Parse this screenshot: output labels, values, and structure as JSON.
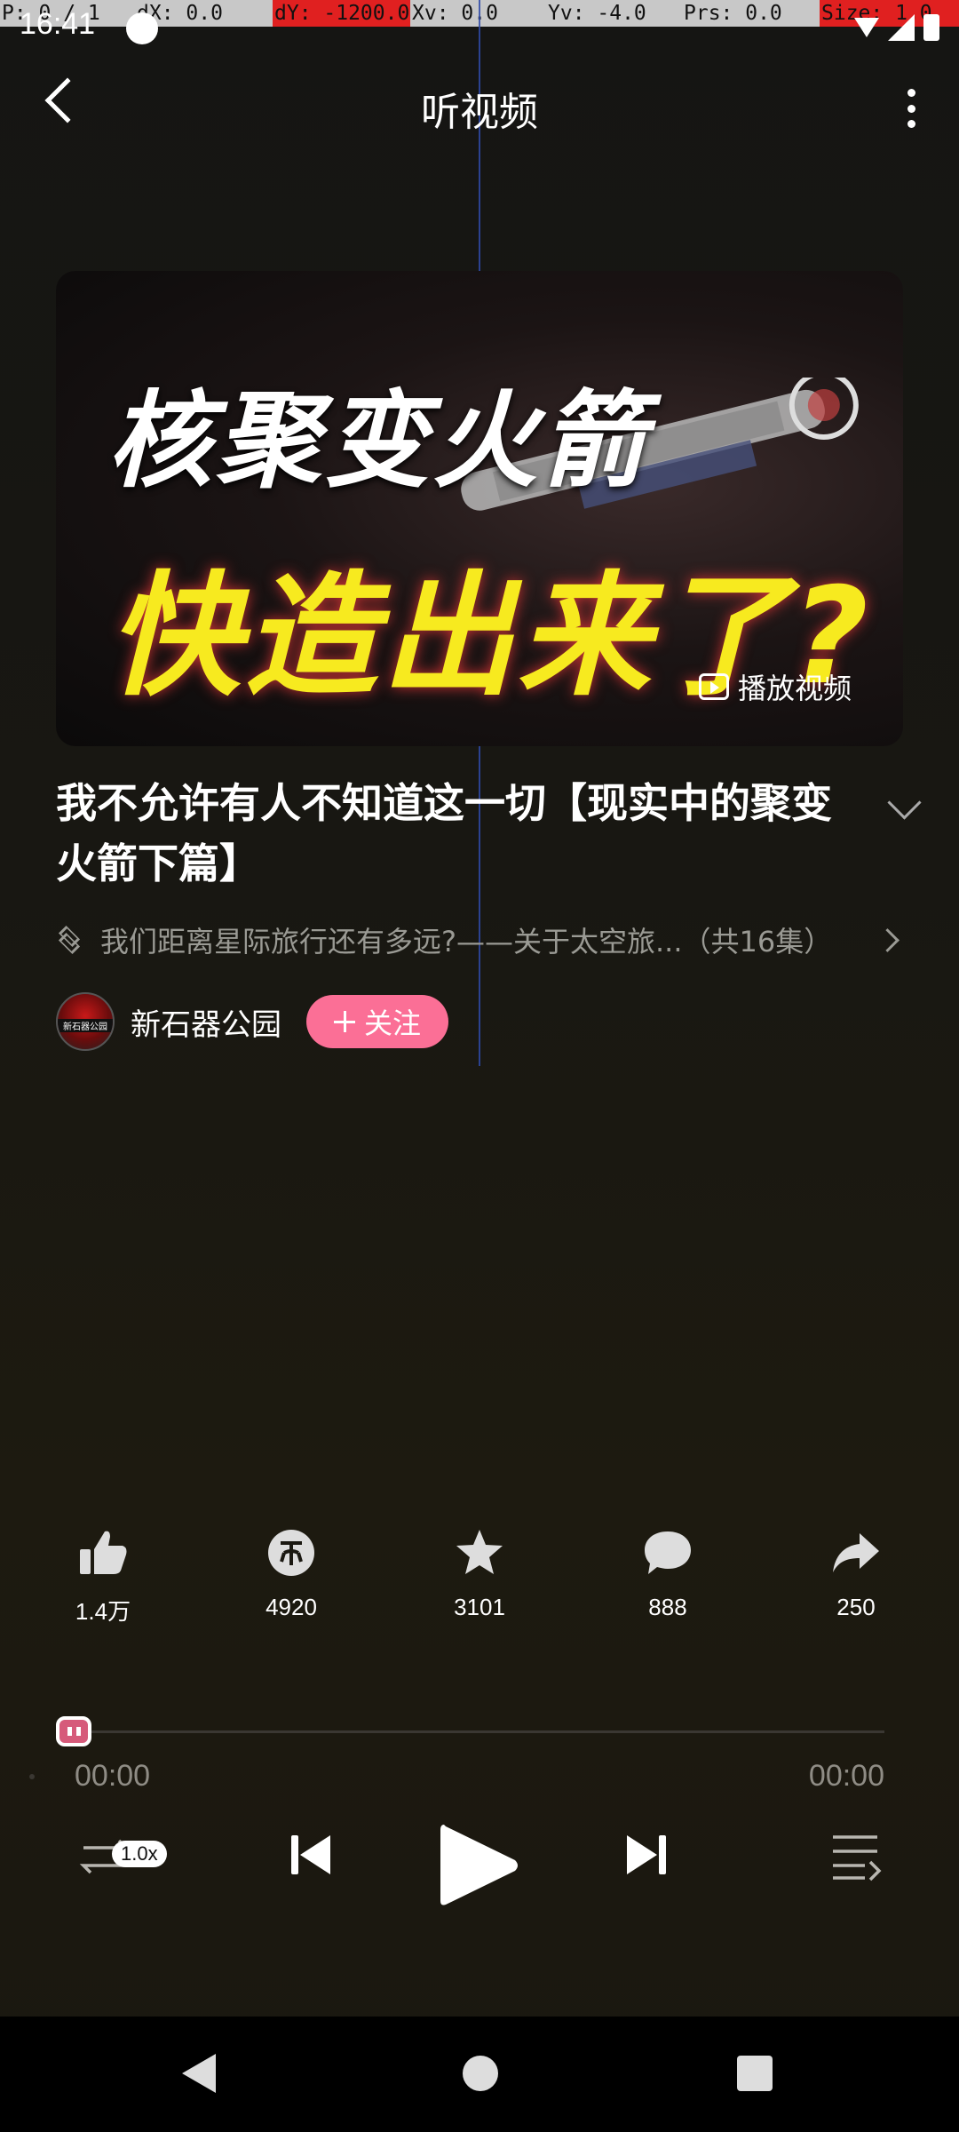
{
  "debug": {
    "cells": [
      {
        "text": "P: 0 / 1",
        "color": "#c8c8c8",
        "width": 152
      },
      {
        "text": "dX: 0.0",
        "color": "#c8c8c8",
        "width": 155
      },
      {
        "text": "dY: -1200.0",
        "color": "#e02020",
        "width": 155
      },
      {
        "text": "Xv: 0.0",
        "color": "#c8c8c8",
        "width": 153
      },
      {
        "text": "Yv: -4.0",
        "color": "#c8c8c8",
        "width": 153
      },
      {
        "text": "Prs: 0.0",
        "color": "#c8c8c8",
        "width": 155
      },
      {
        "text": "Size: 1.0",
        "color": "#e02020",
        "width": 157
      }
    ]
  },
  "status_bar": {
    "time": "16:41"
  },
  "header": {
    "title": "听视频"
  },
  "cover": {
    "line1": "核聚变火箭",
    "line2": "快造出来了?",
    "play_label": "播放视频"
  },
  "episode": {
    "title": "我不允许有人不知道这一切【现实中的聚变火箭下篇】",
    "series": "我们距离星际旅行还有多远?——关于太空旅...（共16集）"
  },
  "author": {
    "name": "新石器公园",
    "avatar_text": "新石器公园",
    "follow_label": "关注"
  },
  "actions": {
    "like": "1.4万",
    "coin": "4920",
    "favorite": "3101",
    "comment": "888",
    "share": "250"
  },
  "player": {
    "elapsed": "00:00",
    "duration": "00:00",
    "speed": "1.0x",
    "progress": 0
  }
}
